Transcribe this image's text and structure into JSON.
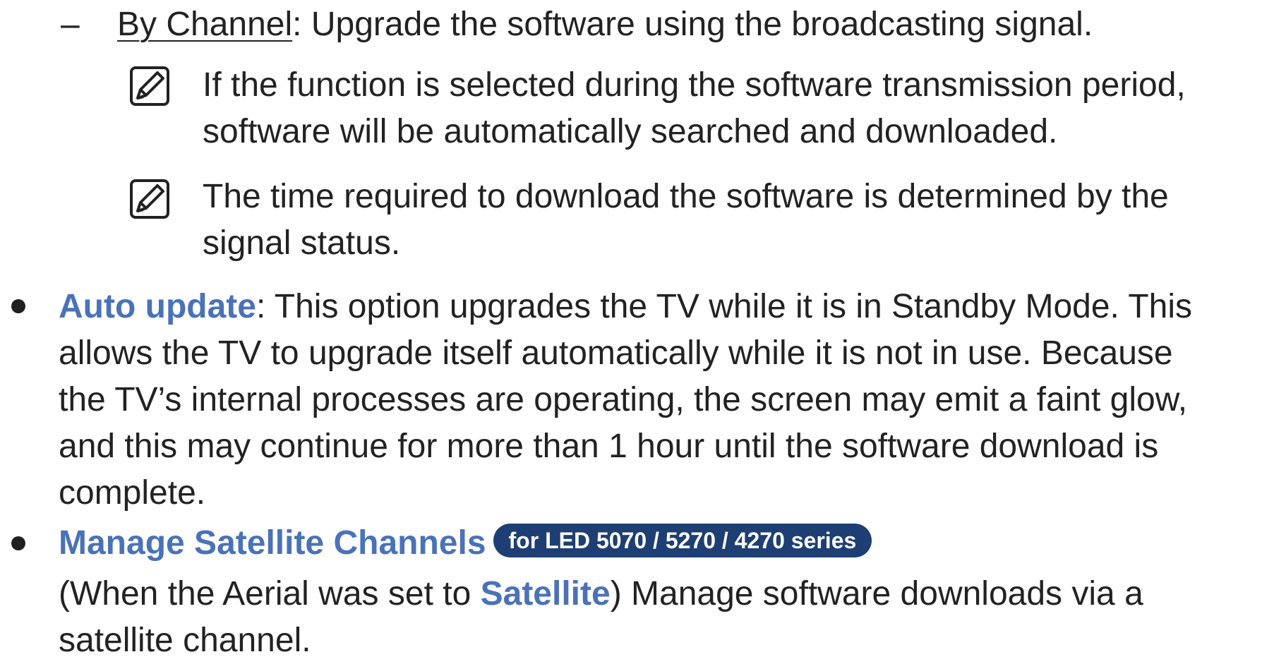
{
  "sub_item": {
    "dash": "–",
    "term": "By Channel",
    "text": ": Upgrade the software using the broadcasting signal."
  },
  "notes": [
    {
      "icon": "note-pencil-icon",
      "lines": [
        "If the function is selected during the software transmission period,",
        "software will be automatically searched and downloaded."
      ]
    },
    {
      "icon": "note-pencil-icon",
      "lines": [
        "The time required to download the software is determined by the",
        "signal status."
      ]
    }
  ],
  "bullets": [
    {
      "term": "Auto update",
      "first_line_rest": ": This option upgrades the TV while it is in Standby Mode. This",
      "lines": [
        "allows the TV to upgrade itself automatically while it is not in use. Because",
        "the TV’s internal processes are operating, the screen may emit a faint glow,",
        "and this may continue for more than 1 hour until the software download is",
        "complete."
      ]
    },
    {
      "term": "Manage Satellite Channels",
      "badge": "for LED 5070 / 5270 / 4270 series",
      "desc_prefix": "(When the Aerial was set to ",
      "desc_term": "Satellite",
      "desc_suffix": ") Manage software downloads via a",
      "desc_line2": "satellite channel."
    }
  ],
  "colors": {
    "term": "#4a72b8",
    "badge_bg": "#1e3f73",
    "text": "#222222"
  }
}
